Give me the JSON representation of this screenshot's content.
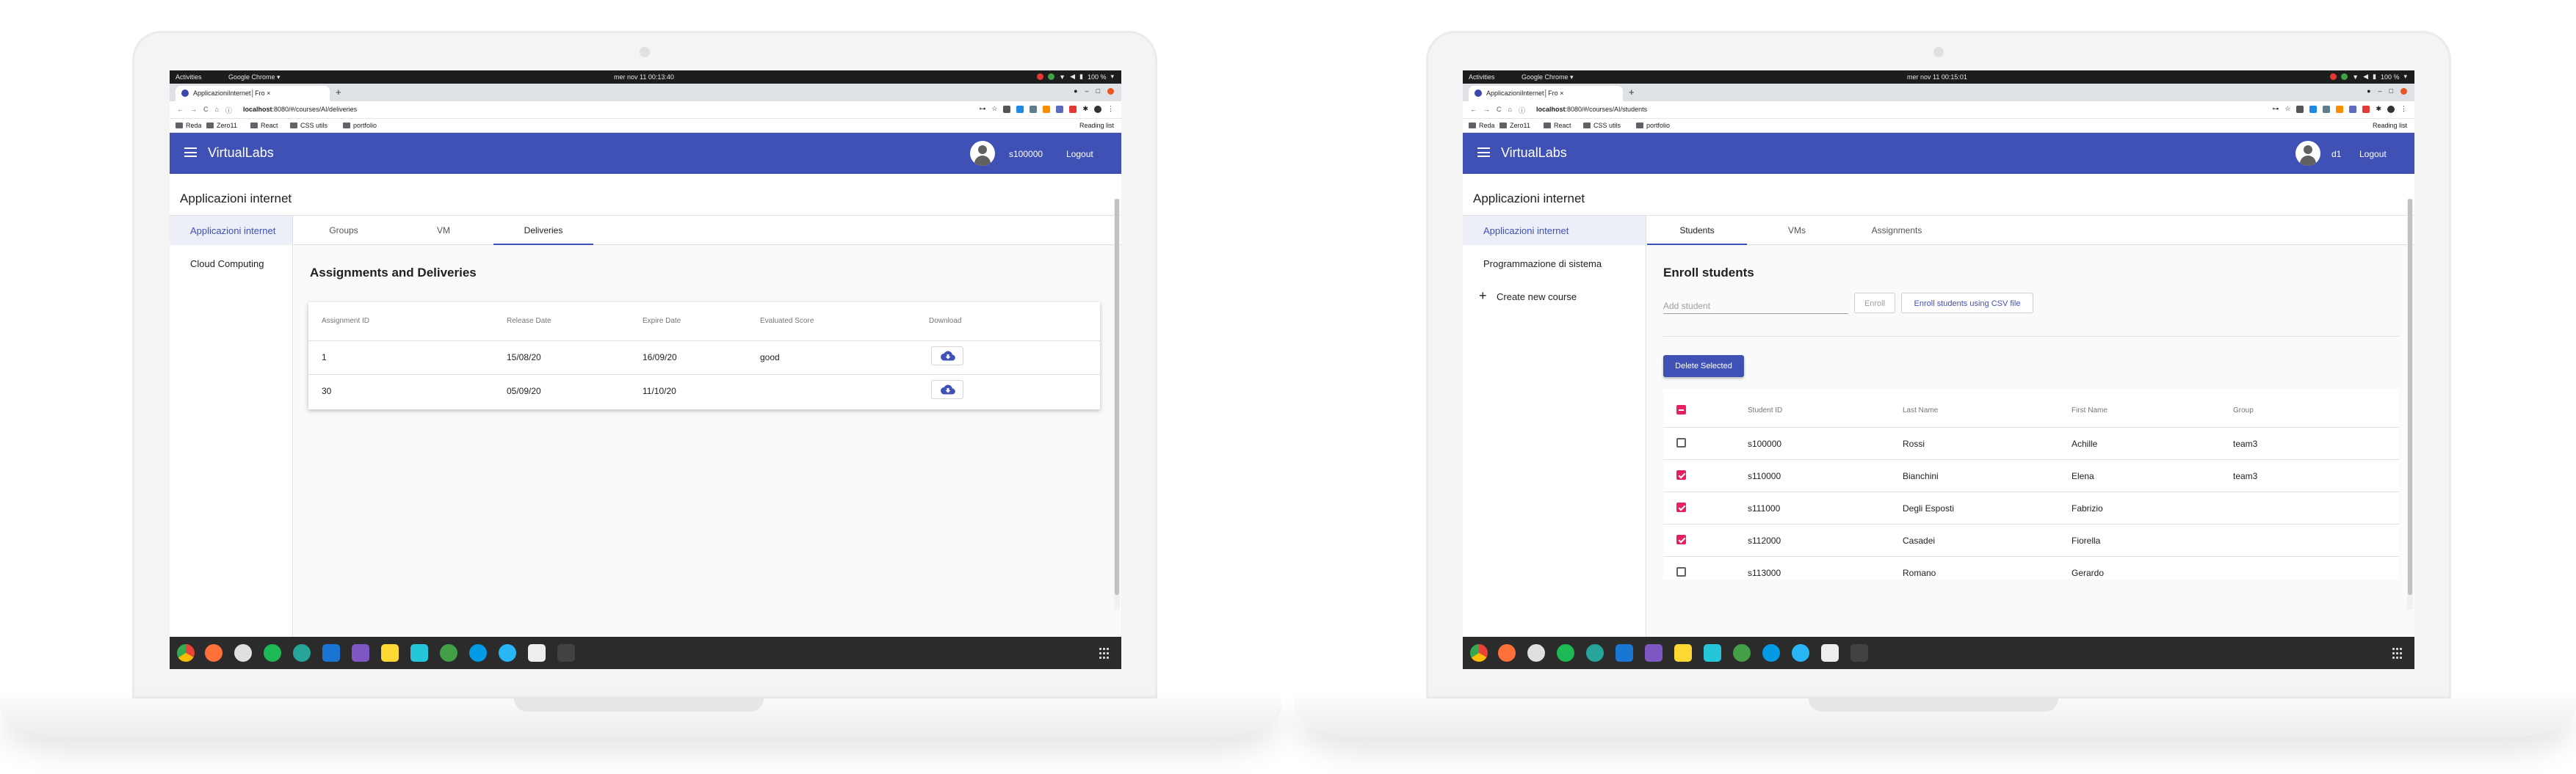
{
  "left": {
    "topbar": {
      "activities": "Activities",
      "app": "Google Chrome ▾",
      "clock": "mer nov 11 00:13:40",
      "battery": "100 %"
    },
    "tab": {
      "title": "ApplicazioniInternet│Fro ×"
    },
    "url": {
      "host": "localhost",
      "path": ":8080/#/courses/AI/deliveries"
    },
    "bookmarks": [
      "Reda",
      "Zero11",
      "React",
      "CSS utils",
      "portfolio"
    ],
    "reading_list": "Reading list",
    "toolbar": {
      "brand": "VirtualLabs",
      "user": "s100000",
      "logout": "Logout"
    },
    "course_title": "Applicazioni internet",
    "nav": [
      "Applicazioni internet",
      "Cloud Computing"
    ],
    "tabs": [
      "Groups",
      "VM",
      "Deliveries"
    ],
    "heading": "Assignments and Deliveries",
    "table": {
      "headers": [
        "Assignment ID",
        "Release Date",
        "Expire Date",
        "Evaluated Score",
        "Download"
      ],
      "rows": [
        [
          "1",
          "15/08/20",
          "16/09/20",
          "good"
        ],
        [
          "30",
          "05/09/20",
          "11/10/20",
          ""
        ]
      ]
    }
  },
  "right": {
    "topbar": {
      "activities": "Activities",
      "app": "Google Chrome ▾",
      "clock": "mer nov 11 00:15:01",
      "battery": "100 %"
    },
    "tab": {
      "title": "ApplicazioniInternet│Fro ×"
    },
    "url": {
      "host": "localhost",
      "path": ":8080/#/courses/AI/students"
    },
    "bookmarks": [
      "Reda",
      "Zero11",
      "React",
      "CSS utils",
      "portfolio"
    ],
    "reading_list": "Reading list",
    "toolbar": {
      "brand": "VirtualLabs",
      "user": "d1",
      "logout": "Logout"
    },
    "course_title": "Applicazioni internet",
    "nav": [
      "Applicazioni internet",
      "Programmazione di sistema",
      "Create new course"
    ],
    "tabs": [
      "Students",
      "VMs",
      "Assignments"
    ],
    "heading": "Enroll students",
    "add_placeholder": "Add student",
    "enroll": "Enroll",
    "enroll_csv": "Enroll students using CSV file",
    "delete_selected": "Delete Selected",
    "table": {
      "headers": [
        "Student ID",
        "Last Name",
        "First Name",
        "Group"
      ],
      "rows": [
        [
          "s100000",
          "Rossi",
          "Achille",
          "team3"
        ],
        [
          "s110000",
          "Bianchini",
          "Elena",
          "team3"
        ],
        [
          "s111000",
          "Degli Esposti",
          "Fabrizio",
          ""
        ],
        [
          "s112000",
          "Casadei",
          "Fiorella",
          ""
        ],
        [
          "s113000",
          "Romano",
          "Gerardo",
          ""
        ]
      ],
      "checked": [
        false,
        true,
        true,
        true,
        false
      ]
    }
  },
  "colors": {
    "primary": "#3f51b5",
    "accent": "#e91e63",
    "dock": "#2b2b2b"
  }
}
